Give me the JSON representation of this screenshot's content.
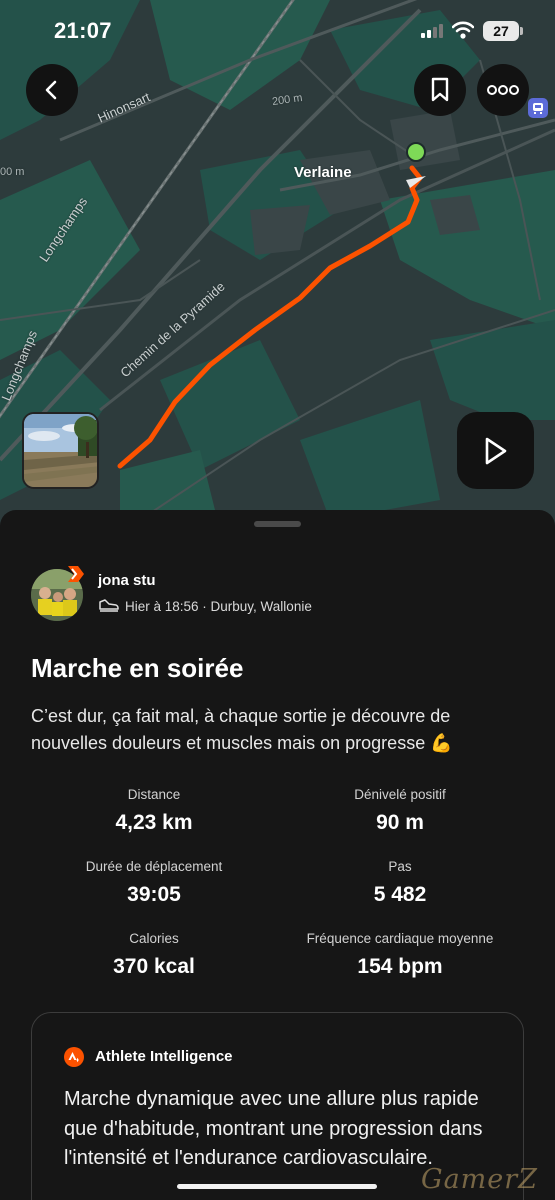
{
  "status_bar": {
    "time": "21:07",
    "battery": "27"
  },
  "map": {
    "labels": {
      "hinonsart": "Hinonsart",
      "elevation_200": "200 m",
      "elevation_edge": "00 m",
      "verlaine": "Verlaine",
      "longchamps_1": "Longchamps",
      "longchamps_2": "Longchamps",
      "chemin": "Chemin de la Pyramide"
    },
    "route_color": "#fc5200",
    "start_color": "#7ed957"
  },
  "actions": {
    "back": "back-arrow-icon",
    "bookmark": "bookmark-icon",
    "more": "more-icon",
    "play": "play-icon"
  },
  "athlete": {
    "name": "jona stu",
    "meta": "Hier à 18:56 · Durbuy, Wallonie"
  },
  "activity": {
    "title": "Marche en soirée",
    "description": "C’est dur, ça fait mal, à chaque sortie je découvre de nouvelles douleurs et muscles mais on progresse 💪"
  },
  "stats": {
    "distance": {
      "label": "Distance",
      "value": "4,23 km"
    },
    "elevation": {
      "label": "Dénivelé positif",
      "value": "90 m"
    },
    "duration": {
      "label": "Durée de déplacement",
      "value": "39:05"
    },
    "steps": {
      "label": "Pas",
      "value": "5 482"
    },
    "calories": {
      "label": "Calories",
      "value": "370 kcal"
    },
    "heartrate": {
      "label": "Fréquence cardiaque moyenne",
      "value": "154 bpm"
    }
  },
  "ai": {
    "title": "Athlete Intelligence",
    "text": "Marche dynamique avec une allure plus rapide que d'habitude, montrant une progression dans l'intensité et l'endurance cardiovasculaire."
  },
  "watermark": "GamerZ",
  "colors": {
    "accent": "#fc5200",
    "background": "#161616"
  }
}
